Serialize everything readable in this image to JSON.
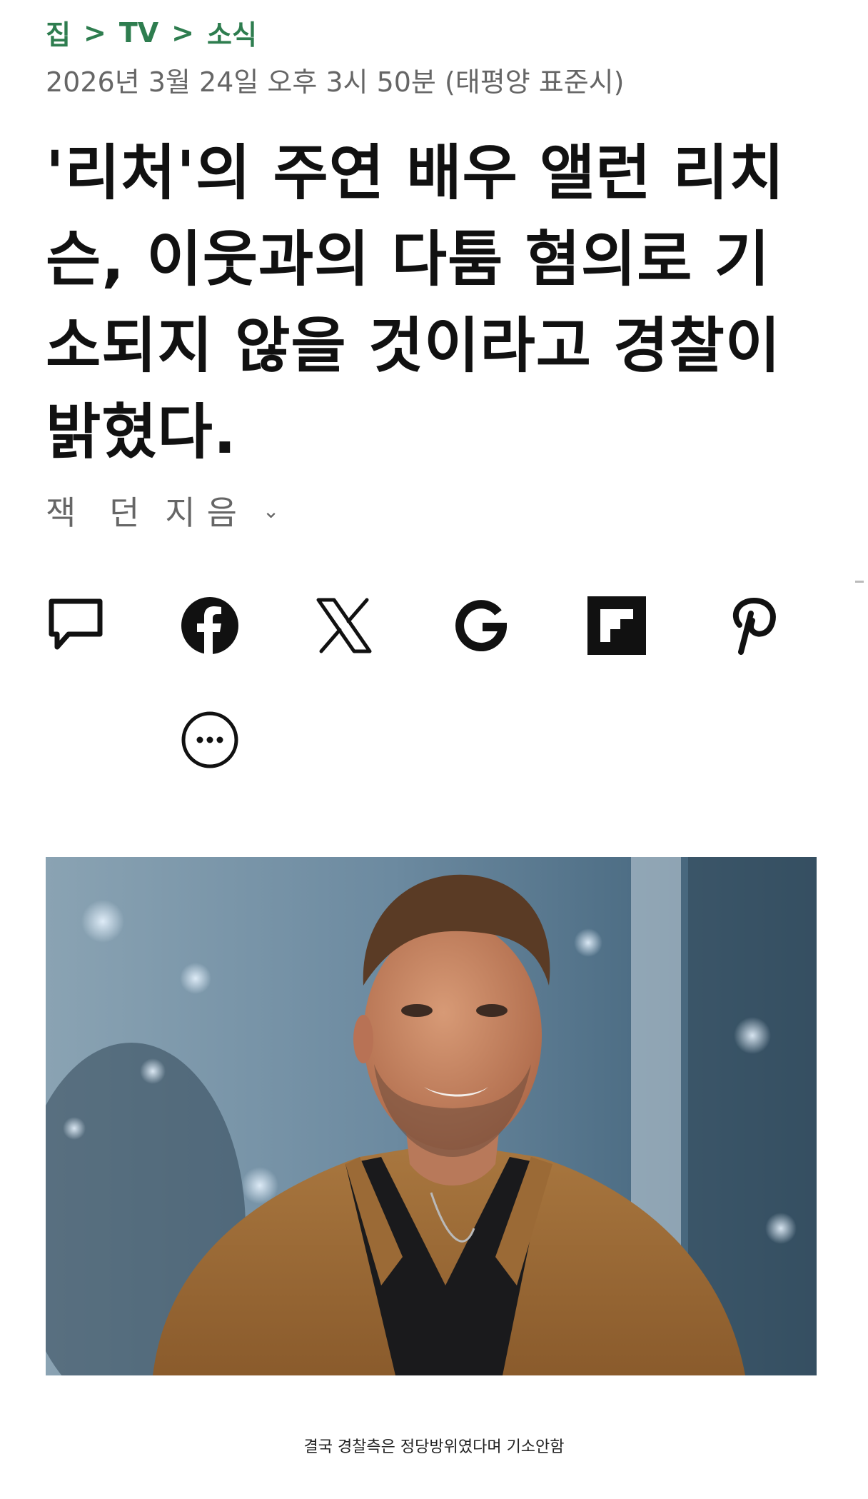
{
  "breadcrumb": {
    "items": [
      "집",
      "TV",
      "소식"
    ],
    "separator": ">"
  },
  "timestamp": "2026년 3월 24일 오후 3시 50분 (태평양 표준시)",
  "headline": "'리처'의 주연 배우 앨런 리치슨, 이웃과의 다툼 혐의로 기소되지 않을 것이라고 경찰이 밝혔다.",
  "byline": {
    "author": "잭 던",
    "suffix": "지음"
  },
  "share": {
    "icons": [
      "comment-icon",
      "facebook-icon",
      "x-icon",
      "google-icon",
      "flipboard-icon",
      "pinterest-icon",
      "more-icon"
    ]
  },
  "photo": {
    "caption": "결국 경찰측은 정당방위였다며 기소안함"
  },
  "colors": {
    "breadcrumb": "#2e7d4f",
    "meta": "#666666",
    "headline": "#111111"
  }
}
